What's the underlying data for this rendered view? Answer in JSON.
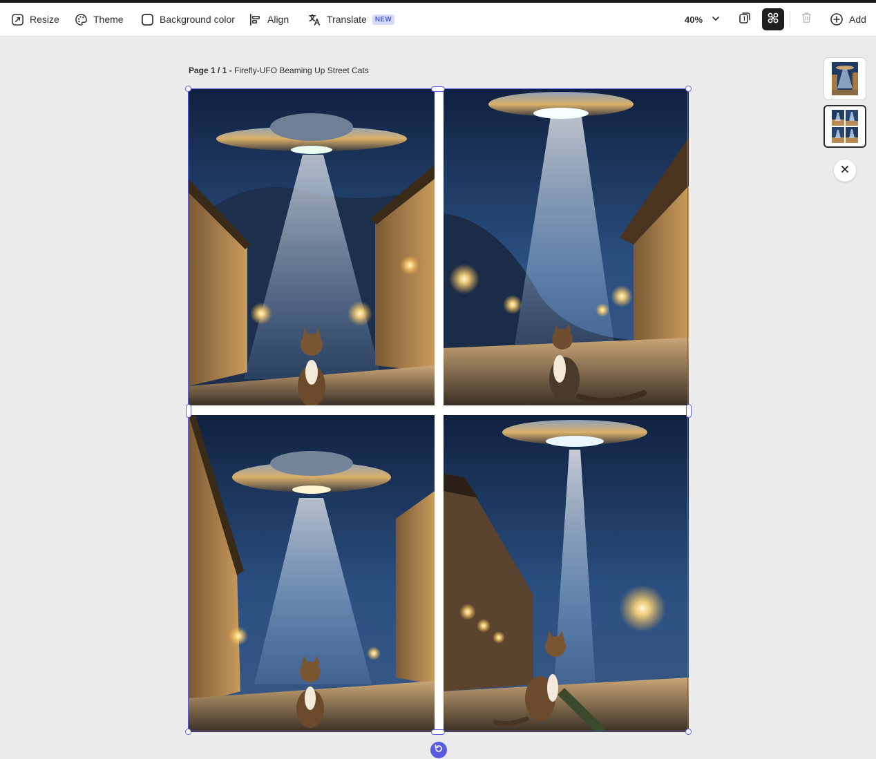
{
  "toolbar": {
    "resize_label": "Resize",
    "theme_label": "Theme",
    "background_color_label": "Background color",
    "align_label": "Align",
    "translate_label": "Translate",
    "translate_badge": "NEW",
    "zoom_value": "40%",
    "add_label": "Add",
    "icons": [
      "resize-icon",
      "theme-palette-icon",
      "background-color-icon",
      "align-icon",
      "translate-icon",
      "chevron-down-icon",
      "duplicate-page-icon",
      "grid-layout-icon",
      "trash-icon",
      "add-circle-icon"
    ]
  },
  "page": {
    "label_prefix": "Page 1 / 1 -",
    "title": "Firefly-UFO Beaming Up Street Cats"
  },
  "canvas": {
    "tiles": [
      {
        "name": "ufo-cat-image-1",
        "position": "top-left"
      },
      {
        "name": "ufo-cat-image-2",
        "position": "top-right"
      },
      {
        "name": "ufo-cat-image-3",
        "position": "bottom-left"
      },
      {
        "name": "ufo-cat-image-4",
        "position": "bottom-right"
      }
    ]
  },
  "side_panel": {
    "thumbnails": [
      "single-image-page-thumbnail",
      "grid-page-thumbnail"
    ],
    "selected_thumbnail": 2
  },
  "colors": {
    "selection": "#5c5ce0",
    "active_button": "#1e1e1e",
    "badge_bg": "#d5dcff",
    "badge_text": "#4b5ae0",
    "night_sky": "#1f3a63"
  }
}
